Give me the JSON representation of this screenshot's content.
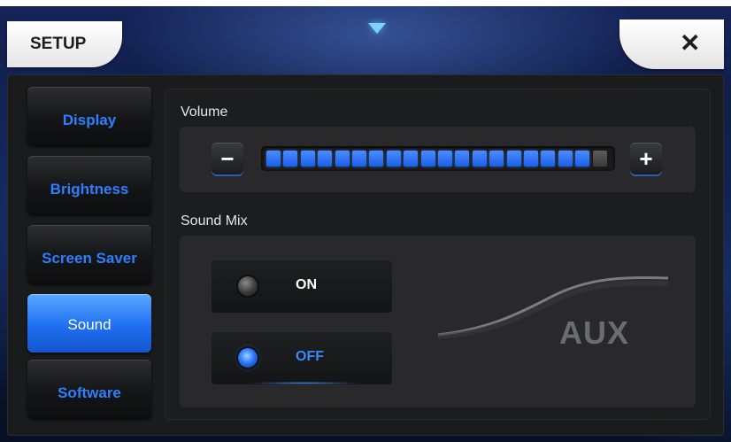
{
  "header": {
    "title": "SETUP",
    "close_label": "✕"
  },
  "sidebar": {
    "items": [
      {
        "label": "Display",
        "active": false
      },
      {
        "label": "Brightness",
        "active": false
      },
      {
        "label": "Screen Saver",
        "active": false
      },
      {
        "label": "Sound",
        "active": true
      },
      {
        "label": "Software",
        "active": false
      }
    ]
  },
  "volume": {
    "label": "Volume",
    "minus_label": "−",
    "plus_label": "+",
    "level_fraction": 0.95
  },
  "sound_mix": {
    "label": "Sound Mix",
    "on_label": "ON",
    "off_label": "OFF",
    "selected": "OFF",
    "source_label": "AUX"
  },
  "colors": {
    "accent": "#2d7fff",
    "active_nav": "#1f6ff2",
    "panel": "#29292b",
    "background": "#0b1638"
  }
}
